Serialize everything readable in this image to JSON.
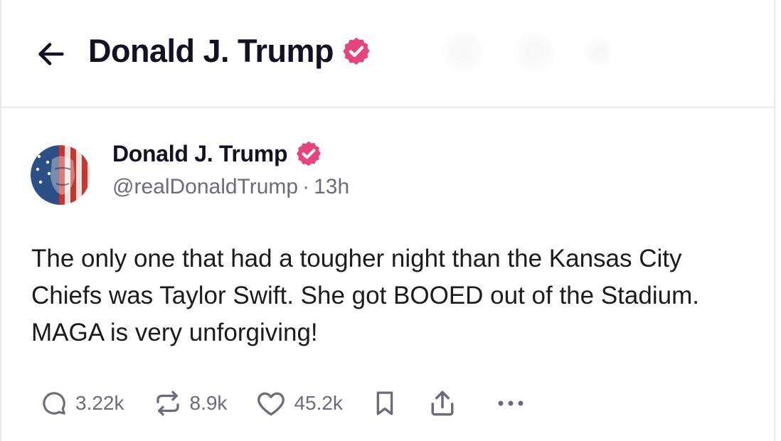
{
  "header": {
    "back_icon": "arrow-left-icon",
    "title": "Donald J. Trump",
    "verified_icon": "verified-badge-icon"
  },
  "post": {
    "author": {
      "name": "Donald J. Trump",
      "handle": "@realDonaldTrump",
      "separator": "·",
      "time": "13h",
      "verified_icon": "verified-badge-icon",
      "avatar_icon": "avatar-flag-portrait"
    },
    "text": "The only one that had a tougher night than the Kansas City Chiefs was Taylor Swift. She got BOOED out of the Stadium. MAGA is very unforgiving!",
    "actions": {
      "reply": {
        "icon": "comment-icon",
        "count": "3.22k"
      },
      "retruth": {
        "icon": "repost-icon",
        "count": "8.9k"
      },
      "like": {
        "icon": "heart-icon",
        "count": "45.2k"
      },
      "bookmark": {
        "icon": "bookmark-icon"
      },
      "share": {
        "icon": "share-icon"
      },
      "more": {
        "icon": "more-dots-icon"
      }
    }
  },
  "colors": {
    "verified": "#e6457a",
    "title_text": "#131225",
    "muted_text": "#6b6b7b",
    "icon_stroke": "#6b6b7b",
    "divider": "#e9e9ee"
  }
}
